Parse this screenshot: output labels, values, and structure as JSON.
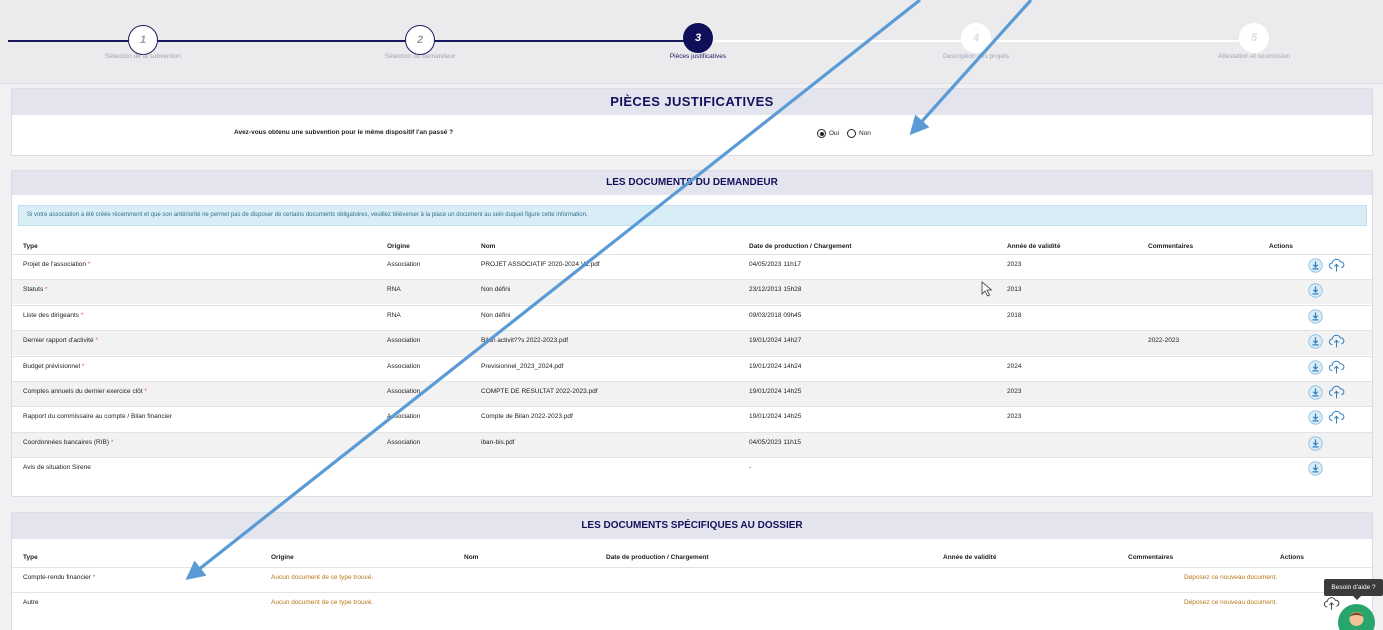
{
  "stepper": {
    "steps": [
      {
        "number": "1",
        "label": "Sélection de la subvention",
        "state": "done"
      },
      {
        "number": "2",
        "label": "Sélection du demandeur",
        "state": "done"
      },
      {
        "number": "3",
        "label": "Pièces justificatives",
        "state": "active"
      },
      {
        "number": "4",
        "label": "Description des projets",
        "state": "todo"
      },
      {
        "number": "5",
        "label": "Attestation et soumission",
        "state": "todo"
      }
    ]
  },
  "pieces": {
    "title": "PIÈCES JUSTIFICATIVES",
    "question": "Avez-vous obtenu une subvention pour le même dispositif l'an passé ?",
    "options": [
      "Oui",
      "Non"
    ],
    "selected": "Oui"
  },
  "demandeur": {
    "title": "LES DOCUMENTS DU DEMANDEUR",
    "info": "Si votre association a été créée récemment et que son antériorité ne permet pas de disposer de certains documents obligatoires, veuillez téléverser à la place un document au sein duquel figure cette information.",
    "columns": [
      "Type",
      "Origine",
      "Nom",
      "Date de production / Chargement",
      "Année de validité",
      "Commentaires",
      "Actions"
    ],
    "rows": [
      {
        "type": "Projet de l'association",
        "required": "*",
        "origine": "Association",
        "nom": "PROJET ASSOCIATIF 2020-2024 V1.pdf",
        "date": "04/05/2023 11h17",
        "annee": "2023",
        "commentaire": "",
        "cloud": true
      },
      {
        "type": "Statuts",
        "required": "*",
        "origine": "RNA",
        "nom": "Non défini",
        "date": "23/12/2013 15h28",
        "annee": "2013",
        "commentaire": "",
        "cloud": false
      },
      {
        "type": "Liste des dirigeants",
        "required": "*",
        "origine": "RNA",
        "nom": "Non défini",
        "date": "09/03/2018 09h45",
        "annee": "2018",
        "commentaire": "",
        "cloud": false
      },
      {
        "type": "Dernier rapport d'activité",
        "required": "*",
        "origine": "Association",
        "nom": "Bilan activit??s 2022-2023.pdf",
        "date": "19/01/2024 14h27",
        "annee": "",
        "commentaire": "2022-2023",
        "cloud": true
      },
      {
        "type": "Budget prévisionnel",
        "required": "*",
        "origine": "Association",
        "nom": "Previsionnel_2023_2024.pdf",
        "date": "19/01/2024 14h24",
        "annee": "2024",
        "commentaire": "",
        "cloud": true
      },
      {
        "type": "Comptes annuels du dernier exercice clôt",
        "required": "*",
        "origine": "Association",
        "nom": "COMPTE DE RESULTAT 2022-2023.pdf",
        "date": "19/01/2024 14h25",
        "annee": "2023",
        "commentaire": "",
        "cloud": true
      },
      {
        "type": "Rapport du commissaire au compte / Bilan financier",
        "required": "",
        "origine": "Association",
        "nom": "Compte de Bilan 2022-2023.pdf",
        "date": "19/01/2024 14h25",
        "annee": "2023",
        "commentaire": "",
        "cloud": true
      },
      {
        "type": "Coordonnées bancaires (RIB)",
        "required": "*",
        "origine": "Association",
        "nom": "iban-bis.pdf",
        "date": "04/05/2023 11h15",
        "annee": "",
        "commentaire": "",
        "cloud": false
      },
      {
        "type": "Avis de situation Sirene",
        "required": "",
        "origine": "",
        "nom": "",
        "date": "-",
        "annee": "",
        "commentaire": "",
        "cloud": false
      }
    ]
  },
  "specifique": {
    "title": "LES DOCUMENTS SPÉCIFIQUES AU DOSSIER",
    "columns": [
      "Type",
      "Origine",
      "Nom",
      "Date de production / Chargement",
      "Année de validité",
      "Commentaires",
      "Actions"
    ],
    "rows": [
      {
        "type": "Compte-rendu financier",
        "required": "*",
        "origine": "Aucun document de ce type trouvé.",
        "action": "Déposez ce nouveau document."
      },
      {
        "type": "Autre",
        "required": "",
        "origine": "Aucun document de ce type trouvé.",
        "action": "Déposez ce nouveau document."
      }
    ]
  },
  "help": {
    "tooltip": "Besoin d'aide ?"
  },
  "colors": {
    "primary": "#12125c",
    "header_bg": "#e4e4ee",
    "required": "#d9534f",
    "info_bg": "#d9edf7",
    "info_text": "#31708f",
    "link": "#b7771a",
    "arrow": "#5b9bd5",
    "help_green": "#27a56b"
  },
  "icons": [
    "download-icon",
    "cloud-upload-icon",
    "mouse-cursor-icon",
    "support-avatar-icon"
  ]
}
